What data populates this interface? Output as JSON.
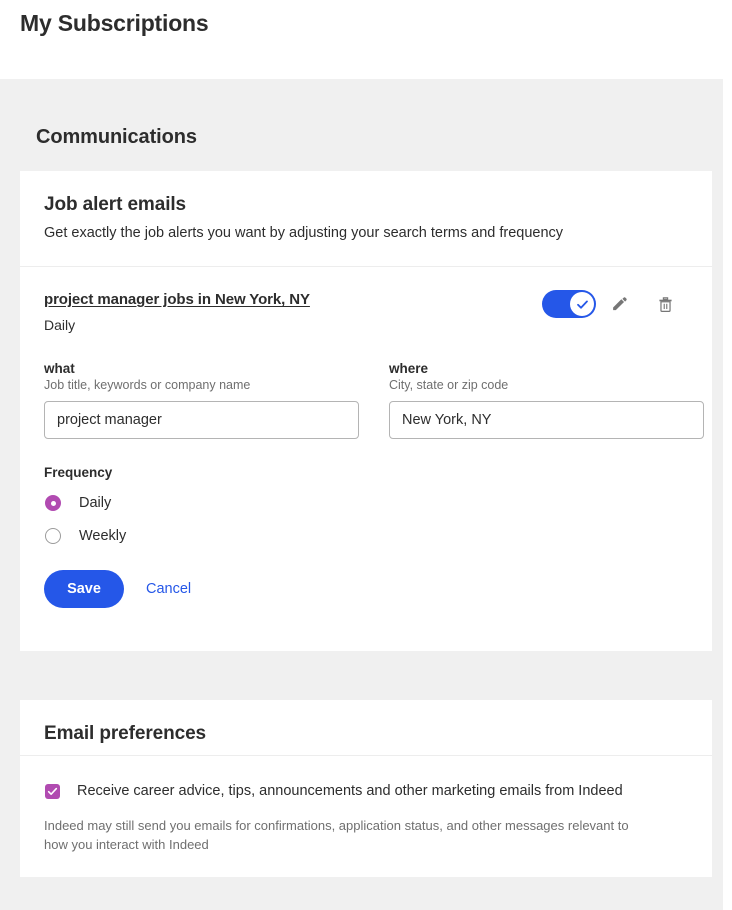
{
  "header": {
    "title": "My Subscriptions"
  },
  "communications": {
    "section_title": "Communications",
    "job_alerts": {
      "card_title": "Job alert emails",
      "card_subtitle": "Get exactly the job alerts you want by adjusting your search terms and frequency",
      "alert": {
        "name": "project manager jobs in New York, NY",
        "frequency_summary": "Daily",
        "toggle_on": true,
        "toggle_icon": "check-icon",
        "edit_icon": "pencil-icon",
        "delete_icon": "trash-icon"
      },
      "form": {
        "what": {
          "label": "what",
          "hint": "Job title, keywords or company name",
          "value": "project manager",
          "placeholder": "Job title, keywords or company name"
        },
        "where": {
          "label": "where",
          "hint": "City, state or zip code",
          "value": "New York, NY",
          "placeholder": "City, state or zip code"
        },
        "frequency": {
          "legend": "Frequency",
          "selected": "Daily",
          "options": [
            {
              "label": "Daily",
              "selected": true
            },
            {
              "label": "Weekly",
              "selected": false
            }
          ]
        },
        "save_label": "Save",
        "cancel_label": "Cancel"
      }
    },
    "email_preferences": {
      "card_title": "Email preferences",
      "marketing_opt_in": {
        "label": "Receive career advice, tips, announcements and other marketing emails from Indeed",
        "checked": true
      },
      "note": "Indeed may still send you emails for confirmations, application status, and other messages relevant to how you interact with Indeed"
    }
  },
  "colors": {
    "accent_blue": "#2557e8",
    "accent_purple": "#b14bb1",
    "page_bg": "#f0f0f0",
    "card_bg": "#ffffff",
    "text_primary": "#2d2d2d",
    "text_muted": "#6f6f6f",
    "border": "#b4b4b4",
    "divider": "#ededed"
  }
}
